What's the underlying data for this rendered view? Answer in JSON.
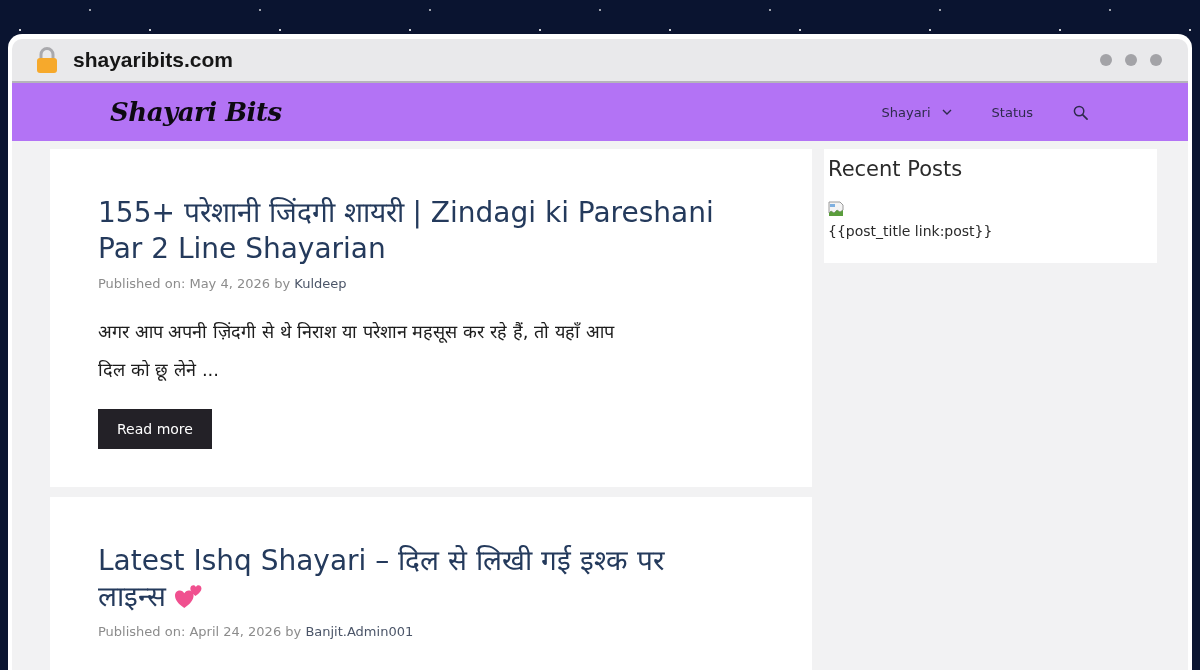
{
  "browser": {
    "url": "shayaribits.com"
  },
  "header": {
    "logo": "Shayari Bits",
    "nav": [
      {
        "label": "Shayari",
        "dropdown": true
      },
      {
        "label": "Status",
        "dropdown": false
      }
    ]
  },
  "posts": [
    {
      "title": "155+ परेशानी जिंदगी शायरी | Zindagi ki Pareshani Par 2 Line Shayarian",
      "title_icon": false,
      "published_label": "Published on:",
      "date": "May 4, 2026",
      "by": "by",
      "author": "Kuldeep",
      "excerpt": "अगर आप अपनी ज़िंदगी से थे निराश या परेशान महसूस कर रहे हैं, तो यहाँ आप दिल को छू लेने ...",
      "button": "Read more"
    },
    {
      "title": "Latest Ishq Shayari – दिल से लिखी गई इश्क पर लाइन्स",
      "title_icon": true,
      "published_label": "Published on:",
      "date": "April 24, 2026",
      "by": "by",
      "author": "Banjit.Admin001"
    }
  ],
  "sidebar": {
    "title": "Recent Posts",
    "posts": [
      {
        "title": "{{post_title link:post}}",
        "image_broken": true
      }
    ]
  }
}
